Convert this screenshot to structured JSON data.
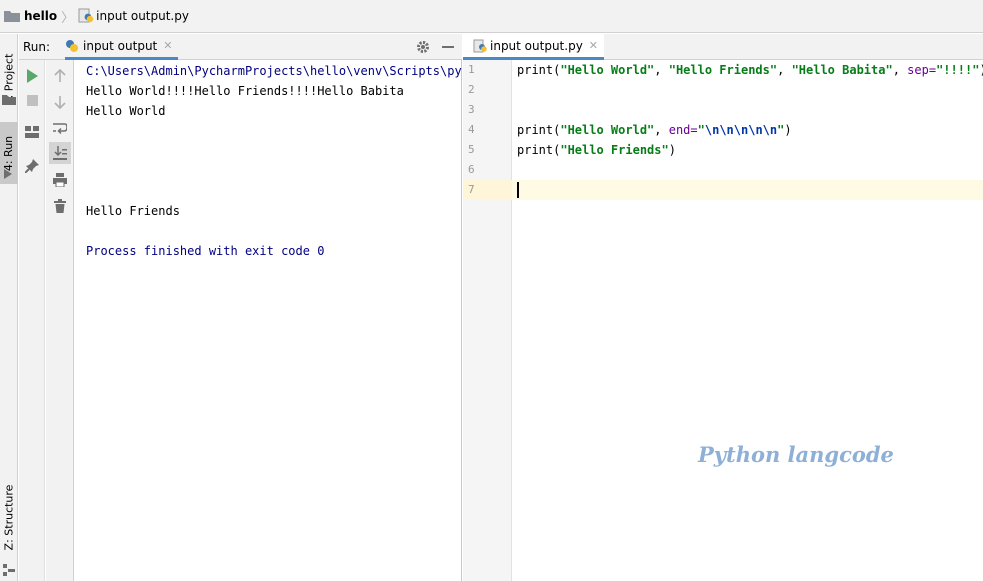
{
  "navbar": {
    "project": "hello",
    "file": "input output.py"
  },
  "left_strip": {
    "project_tab": "1: Project",
    "run_tab": "4: Run",
    "structure_tab": "Z: Structure"
  },
  "run_panel": {
    "label": "Run:",
    "tab_label": "input output",
    "console_lines": {
      "path": "C:\\Users\\Admin\\PycharmProjects\\hello\\venv\\Scripts\\python.exe",
      "line1": "Hello World!!!!Hello Friends!!!!Hello Babita",
      "line2": "Hello World",
      "line3": "Hello Friends",
      "exit": "Process finished with exit code 0"
    }
  },
  "editor": {
    "tab_label": "input output.py",
    "line_numbers": [
      "1",
      "2",
      "3",
      "4",
      "5",
      "6",
      "7"
    ],
    "code": {
      "l1_fn": "print(",
      "l1_s1": "\"Hello World\"",
      "l1_c1": ", ",
      "l1_s2": "\"Hello Friends\"",
      "l1_c2": ", ",
      "l1_s3": "\"Hello Babita\"",
      "l1_c3": ", ",
      "l1_kw": "sep=",
      "l1_s4": "\"!!!!\"",
      "l1_end": ")",
      "l4_fn": "print(",
      "l4_s1": "\"Hello World\"",
      "l4_c1": ", ",
      "l4_kw": "end=",
      "l4_q1": "\"",
      "l4_esc": "\\n\\n\\n\\n\\n",
      "l4_q2": "\"",
      "l4_end": ")",
      "l5_fn": "print(",
      "l5_s1": "\"Hello Friends\"",
      "l5_end": ")"
    },
    "watermark": "Python langcode"
  },
  "colors": {
    "accent_tab": "#4a88c7",
    "string": "#067d17",
    "keyword_arg": "#660099",
    "console_path": "#000080"
  }
}
